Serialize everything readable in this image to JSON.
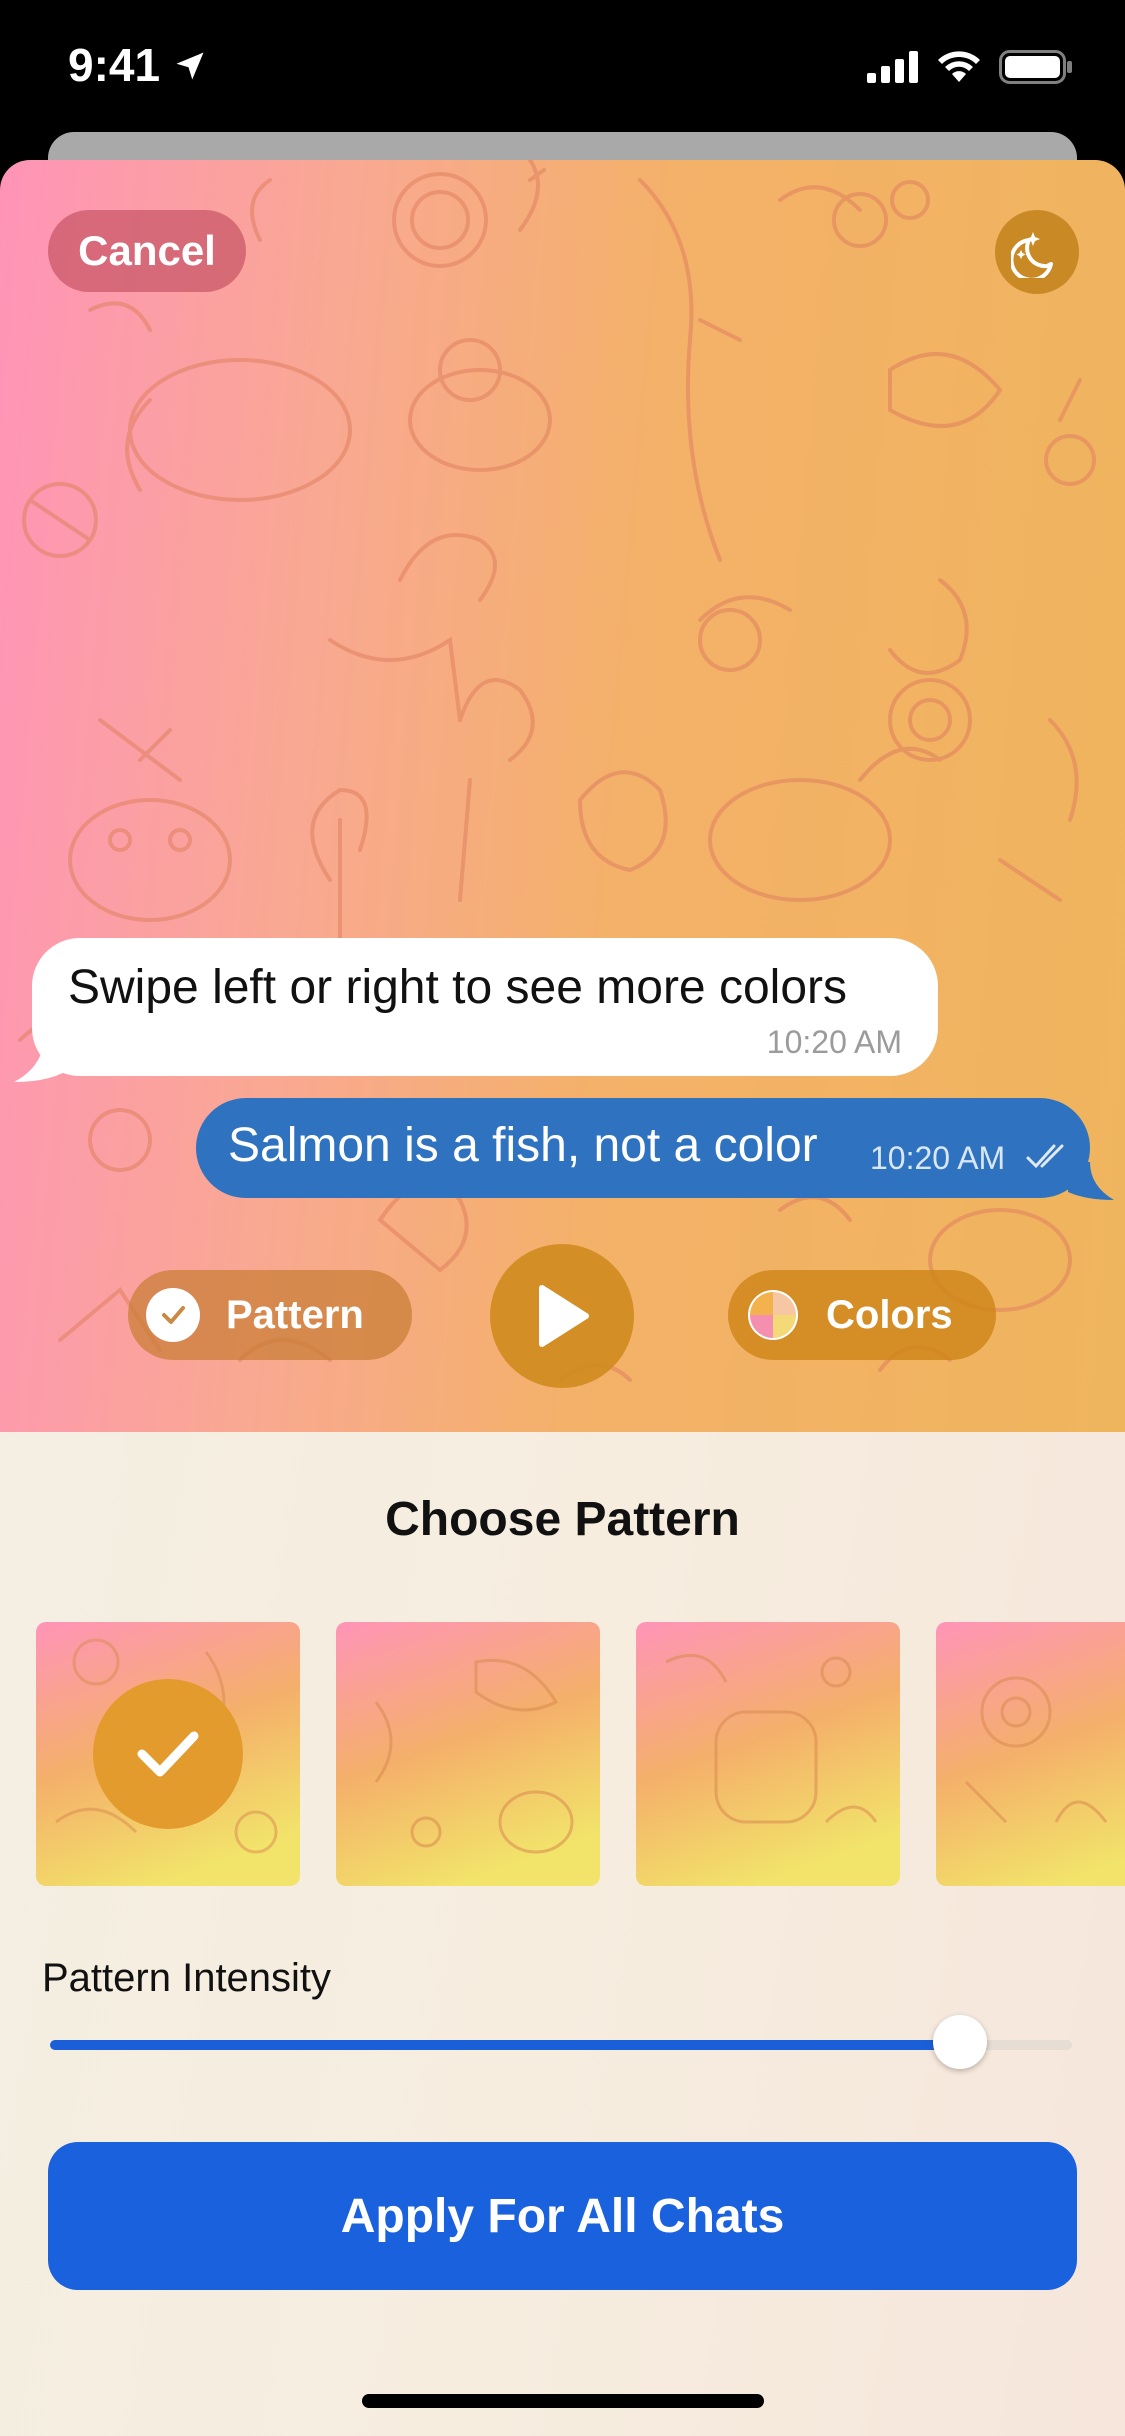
{
  "status_bar": {
    "time": "9:41"
  },
  "preview": {
    "cancel_label": "Cancel",
    "incoming_message": {
      "text": "Swipe left or right to see more colors",
      "time": "10:20 AM"
    },
    "outgoing_message": {
      "text": "Salmon is a fish, not a color",
      "time": "10:20 AM"
    },
    "pattern_label": "Pattern",
    "colors_label": "Colors",
    "icons": [
      "moon-stars-icon",
      "check-circle-icon",
      "play-icon",
      "color-wheel-icon",
      "double-check-icon"
    ]
  },
  "panel": {
    "title": "Choose Pattern",
    "patterns": [
      {
        "id": 1,
        "selected": true
      },
      {
        "id": 2,
        "selected": false
      },
      {
        "id": 3,
        "selected": false
      },
      {
        "id": 4,
        "selected": false
      }
    ],
    "intensity_label": "Pattern Intensity",
    "intensity_value": 0.89,
    "apply_label": "Apply For All Chats"
  },
  "colors": {
    "accent": "#1a61dd",
    "outgoing_bubble": "#2f73c0",
    "gradient_start": "#ff94b8",
    "gradient_end": "#efb55d"
  }
}
